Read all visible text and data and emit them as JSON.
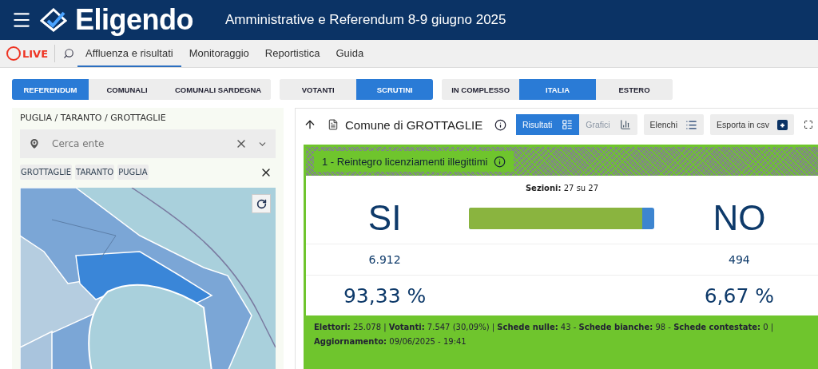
{
  "header": {
    "title": "Eligendo",
    "subtitle": "Amministrative e Referendum 8-9 giugno 2025"
  },
  "nav": {
    "live": "LIVE",
    "items": [
      {
        "label": "Affluenza e risultati",
        "selected": true
      },
      {
        "label": "Monitoraggio",
        "selected": false
      },
      {
        "label": "Reportistica",
        "selected": false
      },
      {
        "label": "Guida",
        "selected": false
      }
    ]
  },
  "segments": [
    {
      "buttons": [
        {
          "label": "REFERENDUM",
          "selected": true
        },
        {
          "label": "COMUNALI",
          "selected": false
        },
        {
          "label": "COMUNALI SARDEGNA",
          "selected": false
        }
      ]
    },
    {
      "buttons": [
        {
          "label": "VOTANTI",
          "selected": false
        },
        {
          "label": "SCRUTINI",
          "selected": true
        }
      ]
    },
    {
      "buttons": [
        {
          "label": "IN COMPLESSO",
          "selected": false
        },
        {
          "label": "ITALIA",
          "selected": true
        },
        {
          "label": "ESTERO",
          "selected": false
        }
      ]
    }
  ],
  "location": {
    "breadcrumb": "PUGLIA / TARANTO / GROTTAGLIE",
    "search": {
      "placeholder": "Cerca ente"
    },
    "chips": [
      "GROTTAGLIE",
      "TARANTO",
      "PUGLIA"
    ]
  },
  "results": {
    "title": "Comune di GROTTAGLIE",
    "views": [
      {
        "label": "Risultati",
        "selected": true
      },
      {
        "label": "Grafici",
        "selected": false
      }
    ],
    "actions": [
      {
        "label": "Elenchi",
        "kind": "list"
      },
      {
        "label": "Esporta in csv",
        "kind": "export"
      }
    ],
    "question": "1 - Reintegro licenziamenti illegittimi",
    "sections": "**Sezioni:** 27 su 27",
    "yes": {
      "label": "SI",
      "votes": "6.912",
      "percent": "93,33 %"
    },
    "no": {
      "label": "NO",
      "votes": "494",
      "percent": "6,67 %"
    },
    "bar": {
      "level": 0.9333
    },
    "footer": "**Elettori:** 25.078 | **Votanti:** 7.547 (30,09%) | **Schede nulle:** 43 - **Schede bianche:** 98 - **Schede contestate:** 0 | **Aggiornamento:** 09/06/2025 - 19:41"
  }
}
